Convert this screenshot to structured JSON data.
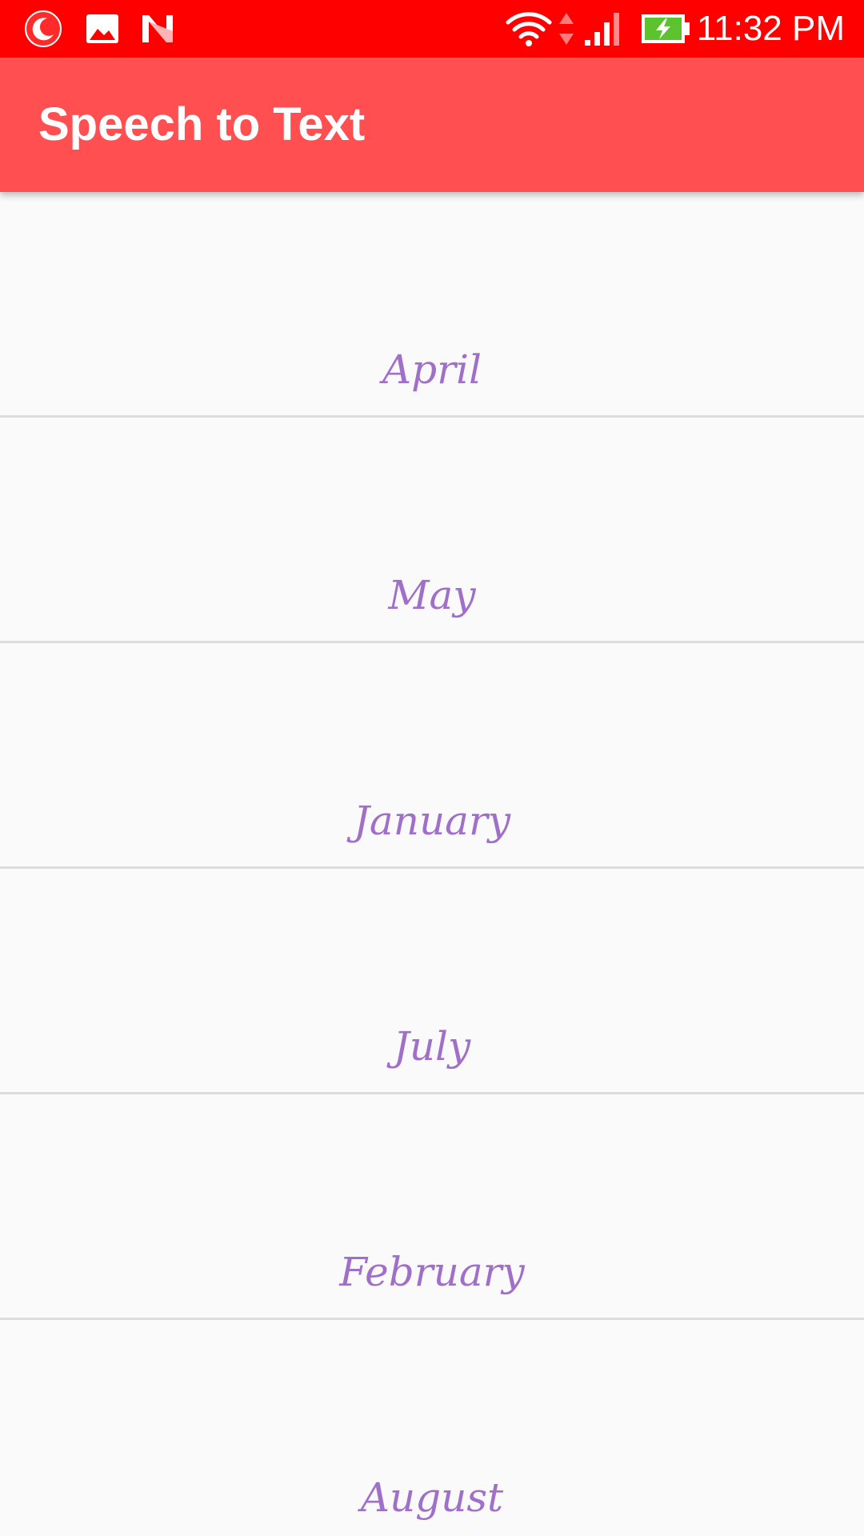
{
  "status_bar": {
    "time": "11:32 PM",
    "left_icons": [
      "moon-notification-icon",
      "image-notification-icon",
      "n-notification-icon"
    ],
    "right_icons": [
      "wifi-icon",
      "data-arrows-icon",
      "signal-icon",
      "battery-charging-icon"
    ],
    "background_color": "#ff0000"
  },
  "app_bar": {
    "title": "Speech to Text",
    "background_color": "#ff4f51"
  },
  "list": {
    "text_color": "#a070c8",
    "items": [
      {
        "label": "April"
      },
      {
        "label": "May"
      },
      {
        "label": "January"
      },
      {
        "label": "July"
      },
      {
        "label": "February"
      },
      {
        "label": "August"
      }
    ]
  }
}
